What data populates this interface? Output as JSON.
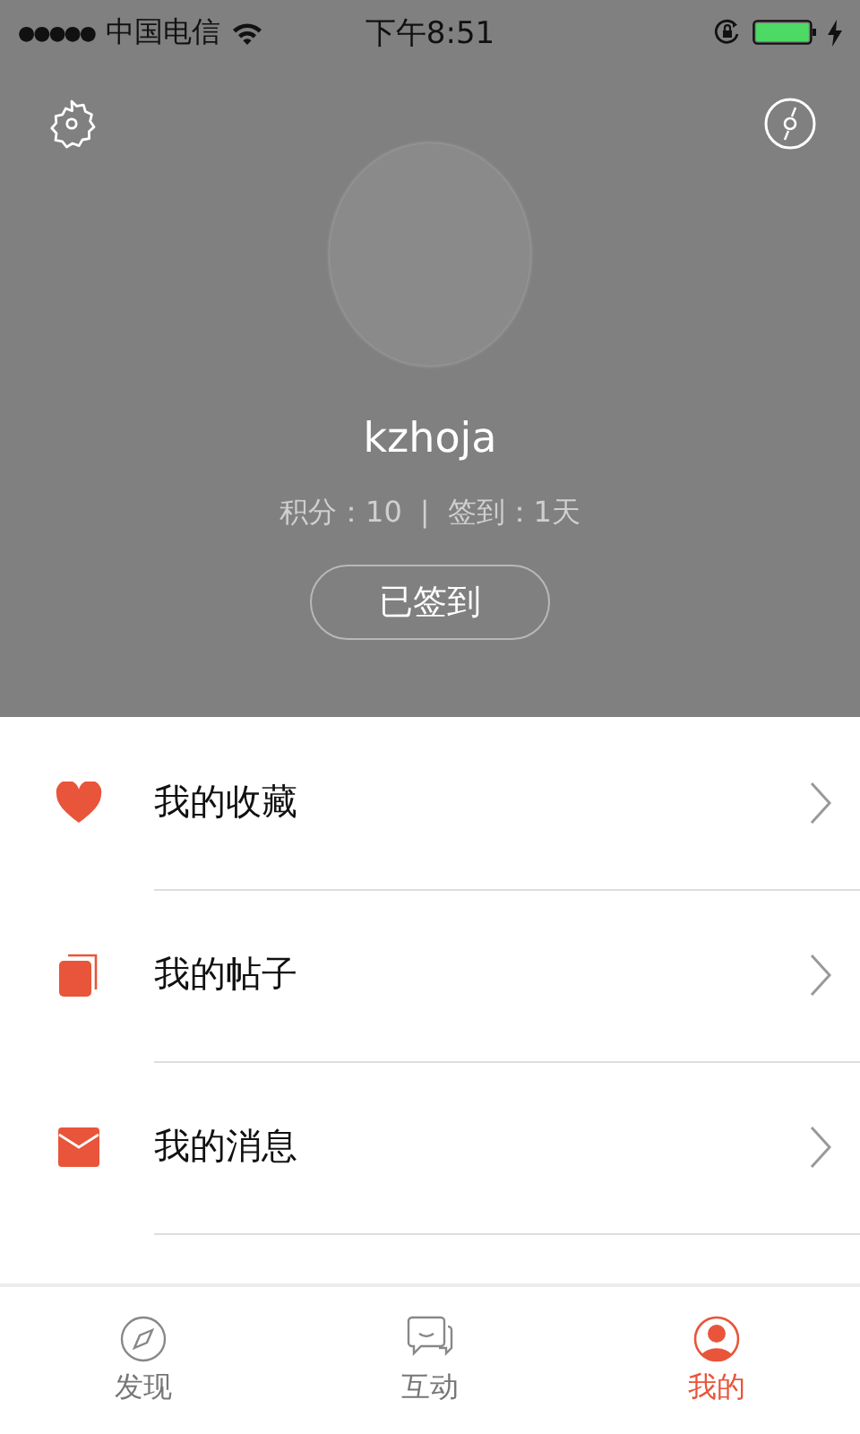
{
  "status_bar": {
    "signal_dots": "●●●●●",
    "carrier": "中国电信",
    "time": "下午8:51"
  },
  "profile": {
    "username": "kzhoja",
    "points": "积分：10",
    "separator": "|",
    "checkin_days": "签到：1天",
    "checkin_button": {
      "label": "已签到",
      "disabled": true
    }
  },
  "menu": [
    {
      "kind": "heart",
      "label": "我的收藏"
    },
    {
      "kind": "posts",
      "label": "我的帖子"
    },
    {
      "kind": "mail",
      "label": "我的消息"
    }
  ],
  "tabs": [
    {
      "kind": "compass",
      "label": "发现",
      "selected": false
    },
    {
      "kind": "chat",
      "label": "互动",
      "selected": false
    },
    {
      "kind": "person",
      "label": "我的",
      "selected": true
    }
  ]
}
